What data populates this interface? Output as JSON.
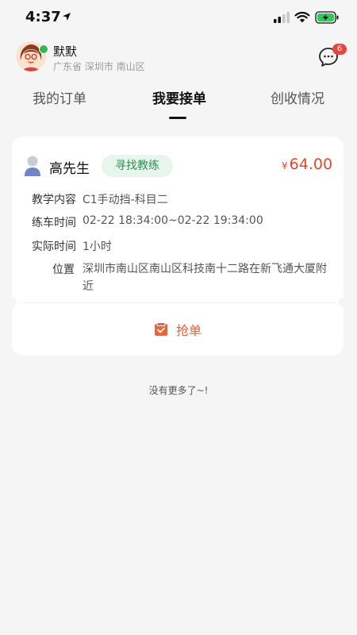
{
  "status_bar": {
    "time": "4:37"
  },
  "header": {
    "user_name": "默默",
    "location": "广东省  深圳市  南山区",
    "message_badge": "6"
  },
  "tabs": [
    {
      "label": "我的订单",
      "active": false
    },
    {
      "label": "我要接单",
      "active": true
    },
    {
      "label": "创收情况",
      "active": false
    }
  ],
  "order": {
    "customer_name": "高先生",
    "tag": "寻找教练",
    "price_symbol": "¥",
    "price": "64.00",
    "rows": [
      {
        "label": "教学内容",
        "value": "C1手动挡-科目二"
      },
      {
        "label": "练车时间",
        "value": "02-22 18:34:00~02-22 19:34:00"
      },
      {
        "label": "实际时间",
        "value": "1小时"
      },
      {
        "label": "位置",
        "value": "深圳市南山区南山区科技南十二路在新飞通大厦附近"
      }
    ],
    "action_label": "抢单"
  },
  "footer": {
    "no_more": "没有更多了~!"
  },
  "colors": {
    "accent": "#e8643c",
    "price": "#e24a2b",
    "tag_bg": "#e6f6ec",
    "tag_text": "#2f8f55",
    "badge": "#e8453c"
  }
}
